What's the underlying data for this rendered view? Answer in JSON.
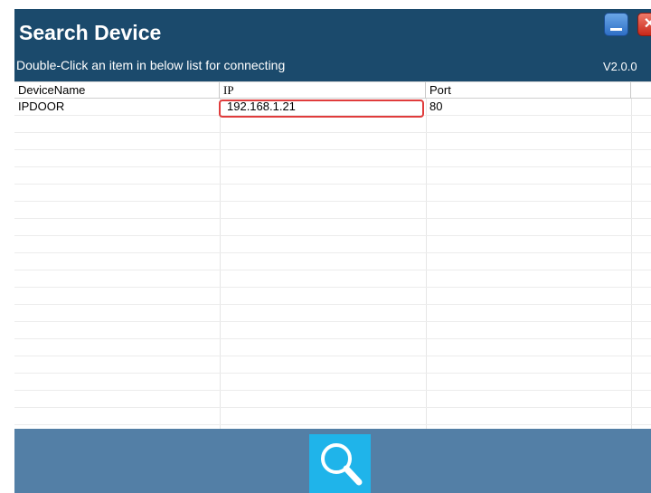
{
  "window": {
    "title": "Search Device",
    "subtitle": "Double-Click an item in below list for connecting",
    "version": "V2.0.0",
    "close_glyph": "✕"
  },
  "colors": {
    "titlebar": "#1b4a6c",
    "footer": "#537fa6",
    "search_button": "#1fb4ea",
    "highlight": "#e03c3c"
  },
  "table": {
    "columns": [
      "DeviceName",
      "IP",
      "Port"
    ],
    "rows": [
      [
        "IPDOOR",
        "192.168.1.21",
        "80"
      ]
    ]
  },
  "footer": {
    "search_icon": "magnifier-icon"
  }
}
